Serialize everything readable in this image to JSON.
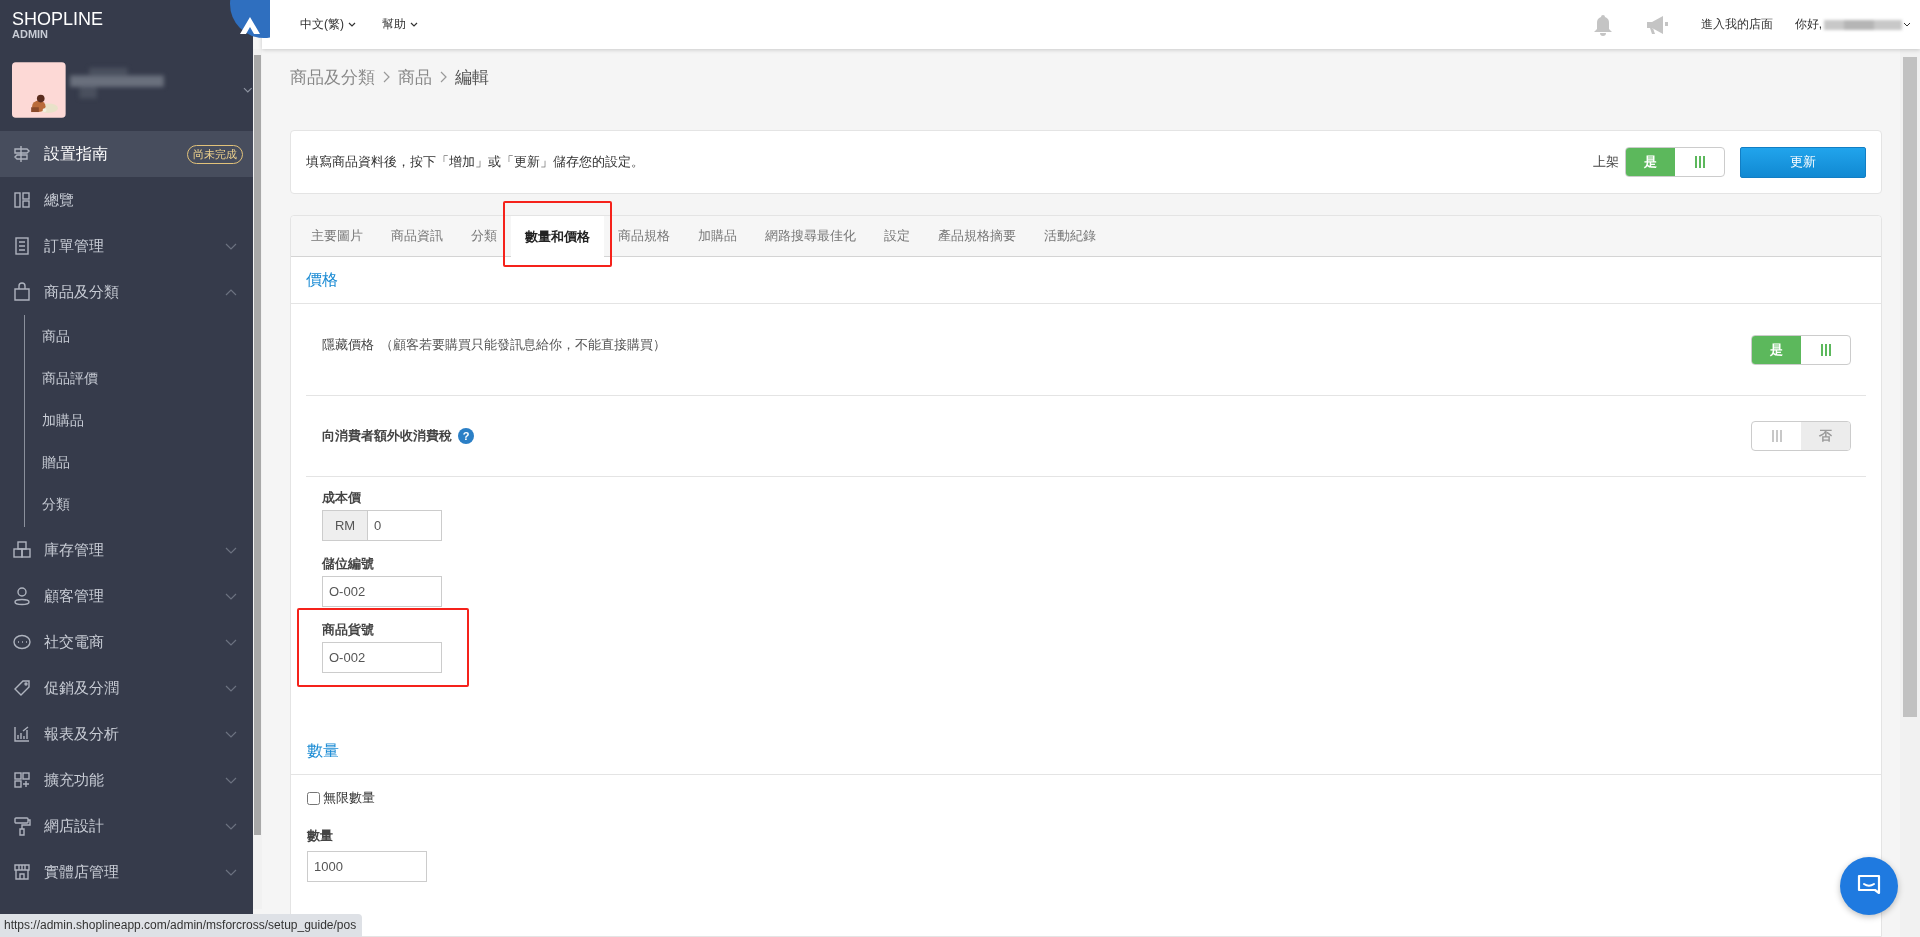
{
  "sidebar": {
    "logo": {
      "brand": "**SHOP**LINE",
      "sub": "ADMIN"
    },
    "items": [
      {
        "label": "設置指南",
        "selected": true,
        "badge": "尚未完成"
      },
      {
        "label": "總覽",
        "selected": false
      },
      {
        "label": "訂單管理",
        "selected": false,
        "expanded": false
      },
      {
        "label": "商品及分類",
        "selected": false,
        "expanded": true,
        "children": [
          {
            "label": "商品",
            "selected": false
          },
          {
            "label": "商品評價",
            "selected": false
          },
          {
            "label": "加購品",
            "selected": false
          },
          {
            "label": "贈品",
            "selected": false
          },
          {
            "label": "分類",
            "selected": false
          }
        ]
      },
      {
        "label": "庫存管理",
        "selected": false,
        "expanded": false
      },
      {
        "label": "顧客管理",
        "selected": false,
        "expanded": false
      },
      {
        "label": "社交電商",
        "selected": false,
        "expanded": false
      },
      {
        "label": "促銷及分潤",
        "selected": false,
        "expanded": false
      },
      {
        "label": "報表及分析",
        "selected": false,
        "expanded": false
      },
      {
        "label": "擴充功能",
        "selected": false,
        "expanded": false
      },
      {
        "label": "網店設計",
        "selected": false,
        "expanded": false
      },
      {
        "label": "實體店管理",
        "selected": false,
        "expanded": false
      }
    ]
  },
  "topbar": {
    "menus": [
      {
        "label": "中文(繁)"
      },
      {
        "label": "幫助"
      }
    ],
    "store_link": "進入我的店面",
    "greeting": "你好,"
  },
  "breadcrumb": [
    "商品及分類",
    "商品",
    "編輯"
  ],
  "notice": {
    "text": "填寫商品資料後，按下「增加」或「更新」儲存您的設定。",
    "publish": {
      "label": "上架",
      "on": true,
      "text": "是"
    },
    "update_button": "更新"
  },
  "tabs": [
    {
      "label": "主要圖片",
      "selected": false,
      "highlighted": false
    },
    {
      "label": "商品資訊",
      "selected": false,
      "highlighted": false
    },
    {
      "label": "分類",
      "selected": false,
      "highlighted": false
    },
    {
      "label": "數量和價格",
      "selected": true,
      "highlighted": true
    },
    {
      "label": "商品規格",
      "selected": false,
      "highlighted": false
    },
    {
      "label": "加購品",
      "selected": false,
      "highlighted": false
    },
    {
      "label": "網路搜尋最佳化",
      "selected": false,
      "highlighted": false
    },
    {
      "label": "設定",
      "selected": false,
      "highlighted": false
    },
    {
      "label": "產品規格摘要",
      "selected": false,
      "highlighted": false
    },
    {
      "label": "活動紀錄",
      "selected": false,
      "highlighted": false
    }
  ],
  "price_section": {
    "title": "價格",
    "toggles": [
      {
        "label": "隱藏價格",
        "hint": "（顧客若要購買只能發訊息給你，不能直接購買）",
        "on": true,
        "text": "是"
      },
      {
        "label": "向消費者額外收消費稅",
        "help": "?",
        "on": false,
        "text": "否"
      }
    ],
    "fields": [
      {
        "label": "成本價",
        "prefix": "RM",
        "value": "0",
        "highlighted": false
      },
      {
        "label": "儲位編號",
        "value": "O-002",
        "highlighted": false
      },
      {
        "label": "商品貨號",
        "value": "O-002",
        "highlighted": true
      }
    ]
  },
  "quantity_section": {
    "title": "數量",
    "unlimited": {
      "label": "無限數量",
      "checked": false
    },
    "field": {
      "label": "數量",
      "value": "1000"
    }
  },
  "status_url": "https://admin.shoplineapp.com/admin/msforcross/setup_guide/pos"
}
